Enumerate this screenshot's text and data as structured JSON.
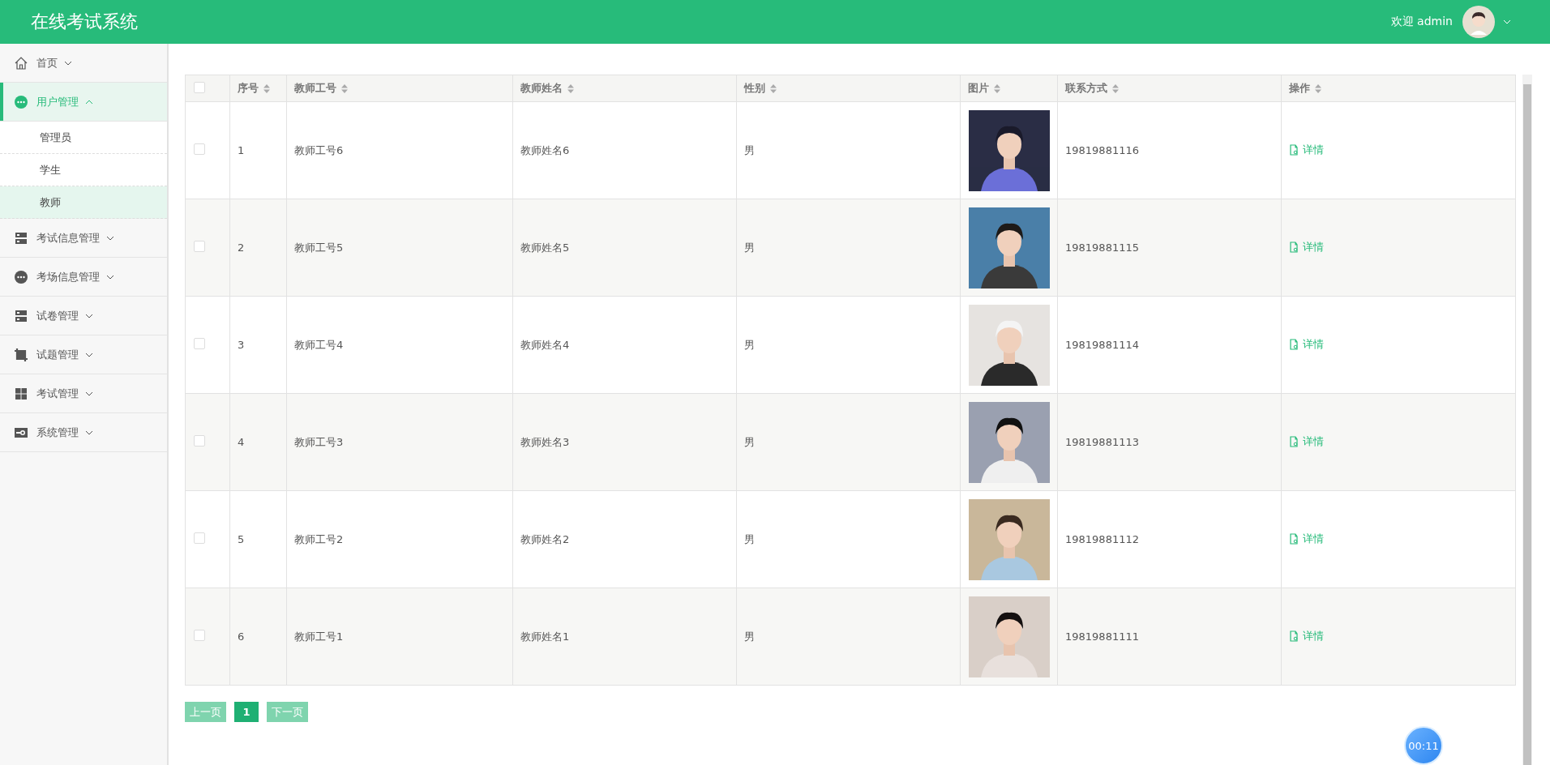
{
  "header": {
    "title": "在线考试系统",
    "greeting": "欢迎 admin"
  },
  "sidebar": {
    "items": [
      {
        "label": "首页",
        "expanded": false,
        "selected": false
      },
      {
        "label": "用户管理",
        "expanded": true,
        "selected": true,
        "children": [
          {
            "label": "管理员",
            "selected": false
          },
          {
            "label": "学生",
            "selected": false
          },
          {
            "label": "教师",
            "selected": true
          }
        ]
      },
      {
        "label": "考试信息管理",
        "expanded": false,
        "selected": false
      },
      {
        "label": "考场信息管理",
        "expanded": false,
        "selected": false
      },
      {
        "label": "试卷管理",
        "expanded": false,
        "selected": false
      },
      {
        "label": "试题管理",
        "expanded": false,
        "selected": false
      },
      {
        "label": "考试管理",
        "expanded": false,
        "selected": false
      },
      {
        "label": "系统管理",
        "expanded": false,
        "selected": false
      }
    ]
  },
  "table": {
    "select_all_checked": false,
    "columns": [
      "序号",
      "教师工号",
      "教师姓名",
      "性别",
      "图片",
      "联系方式",
      "操作"
    ],
    "rows": [
      {
        "checked": false,
        "no": "1",
        "id": "教师工号6",
        "name": "教师姓名6",
        "gender": "男",
        "phone": "19819881116",
        "action": "详情"
      },
      {
        "checked": false,
        "no": "2",
        "id": "教师工号5",
        "name": "教师姓名5",
        "gender": "男",
        "phone": "19819881115",
        "action": "详情"
      },
      {
        "checked": false,
        "no": "3",
        "id": "教师工号4",
        "name": "教师姓名4",
        "gender": "男",
        "phone": "19819881114",
        "action": "详情"
      },
      {
        "checked": false,
        "no": "4",
        "id": "教师工号3",
        "name": "教师姓名3",
        "gender": "男",
        "phone": "19819881113",
        "action": "详情"
      },
      {
        "checked": false,
        "no": "5",
        "id": "教师工号2",
        "name": "教师姓名2",
        "gender": "男",
        "phone": "19819881112",
        "action": "详情"
      },
      {
        "checked": false,
        "no": "6",
        "id": "教师工号1",
        "name": "教师姓名1",
        "gender": "男",
        "phone": "19819881111",
        "action": "详情"
      }
    ]
  },
  "pagination": {
    "prev": "上一页",
    "pages": [
      {
        "label": "1",
        "selected": true
      }
    ],
    "next": "下一页"
  },
  "timer": "00:11"
}
